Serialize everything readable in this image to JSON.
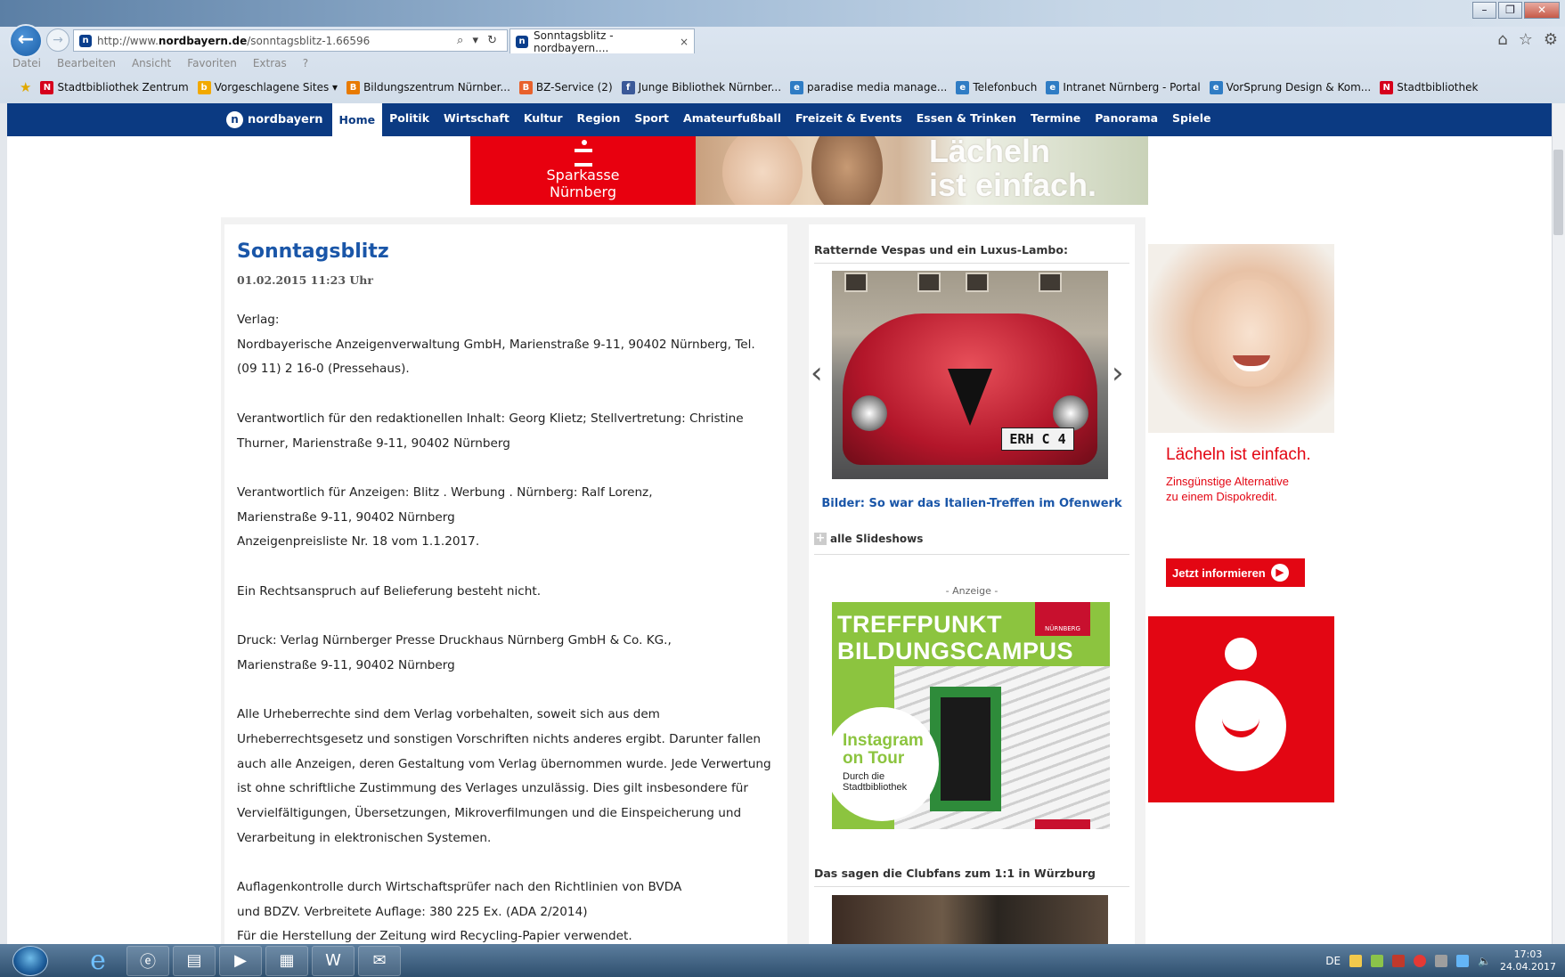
{
  "browser": {
    "url_prefix": "http://www.",
    "url_domain": "nordbayern.de",
    "url_path": "/sonntagsblitz-1.66596",
    "address_controls": "⌕ ▾ ↻",
    "tab_title": "Sonntagsblitz - nordbayern....",
    "tab_close": "×",
    "menu": [
      "Datei",
      "Bearbeiten",
      "Ansicht",
      "Favoriten",
      "Extras",
      "?"
    ],
    "favorites": [
      {
        "label": "Stadtbibliothek Zentrum",
        "icon": "N",
        "color": "#d6001c"
      },
      {
        "label": "Vorgeschlagene Sites ▾",
        "icon": "b",
        "color": "#f2a900"
      },
      {
        "label": "Bildungszentrum Nürnber...",
        "icon": "B",
        "color": "#e87a00"
      },
      {
        "label": "BZ-Service (2)",
        "icon": "B",
        "color": "#e8612c"
      },
      {
        "label": "Junge Bibliothek Nürnber...",
        "icon": "f",
        "color": "#3b5998"
      },
      {
        "label": "paradise media manage...",
        "icon": "e",
        "color": "#2f7cc4"
      },
      {
        "label": "Telefonbuch",
        "icon": "e",
        "color": "#2f7cc4"
      },
      {
        "label": "Intranet Nürnberg - Portal",
        "icon": "e",
        "color": "#2f7cc4"
      },
      {
        "label": "VorSprung Design & Kom...",
        "icon": "e",
        "color": "#2f7cc4"
      },
      {
        "label": "Stadtbibliothek",
        "icon": "N",
        "color": "#d6001c"
      }
    ]
  },
  "site": {
    "logo": "nordbayern",
    "logo_mark": "n",
    "nav": [
      "Home",
      "Politik",
      "Wirtschaft",
      "Kultur",
      "Region",
      "Sport",
      "Amateurfußball",
      "Freizeit & Events",
      "Essen & Trinken",
      "Termine",
      "Panorama",
      "Spiele"
    ],
    "active_nav": "Home"
  },
  "banner_ad": {
    "brand_line1": "Sparkasse",
    "brand_line2": "Nürnberg",
    "slogan_line1": "Lächeln",
    "slogan_line2": "ist einfach."
  },
  "article": {
    "title": "Sonntagsblitz",
    "date": "01.02.2015 11:23 Uhr",
    "paragraphs": [
      [
        "Verlag:",
        "Nordbayerische Anzeigenverwaltung GmbH, Marienstraße 9-11, 90402 Nürnberg, Tel. (09 11) 2 16-0 (Pressehaus)."
      ],
      [
        "Verantwortlich für den redaktionellen Inhalt: Georg Klietz; Stellvertretung: Christine Thurner, Marienstraße 9-11, 90402 Nürnberg"
      ],
      [
        "Verantwortlich für Anzeigen: Blitz . Werbung . Nürnberg: Ralf Lorenz,",
        "Marienstraße 9-11, 90402 Nürnberg",
        "Anzeigenpreisliste Nr. 18 vom 1.1.2017."
      ],
      [
        "Ein Rechtsanspruch auf Belieferung besteht nicht."
      ],
      [
        "Druck: Verlag Nürnberger Presse Druckhaus Nürnberg GmbH & Co. KG.,",
        "Marienstraße 9-11, 90402 Nürnberg"
      ],
      [
        "Alle Urheberrechte sind dem Verlag vorbehalten, soweit sich aus dem Urheberrechtsgesetz und sonstigen Vorschriften nichts anderes ergibt. Darunter fallen auch alle Anzeigen, deren Gestaltung vom Verlag übernommen wurde. Jede Verwertung ist ohne schriftliche Zustimmung des Verlages unzulässig. Dies gilt insbesondere für Vervielfältigungen, Übersetzungen, Mikroverfilmungen und die Einspeicherung und Verarbeitung in elektronischen Systemen."
      ],
      [
        "Auflagenkontrolle durch Wirtschaftsprüfer nach den Richtlinien von BVDA",
        "und BDZV. Verbreitete Auflage: 380 225 Ex. (ADA 2/2014)",
        "Für die Herstellung der Zeitung wird Recycling-Papier verwendet."
      ]
    ]
  },
  "sidebar": {
    "slideshow_heading": "Ratternde Vespas und ein Luxus-Lambo:",
    "plate_text": "ERH C 4",
    "slide_caption": "Bilder: So war das Italien-Treffen im Ofenwerk",
    "all_slideshows": "alle Slideshows",
    "ad_label": "- Anzeige -",
    "campus_ad": {
      "title_line1": "TREFFPUNKT",
      "title_line2": "BILDUNGSCAMPUS",
      "badge": "NÜRNBERG",
      "insta_line1": "Instagram",
      "insta_line2": "on Tour",
      "sub_line1": "Durch die",
      "sub_line2": "Stadtbibliothek"
    },
    "video_heading": "Das sagen die Clubfans zum 1:1 in Würzburg"
  },
  "side_ad": {
    "headline": "Lächeln ist einfach.",
    "sub_line1": "Zinsgünstige Alternative",
    "sub_line2": "zu einem Dispokredit.",
    "button": "Jetzt informieren",
    "accent": "#e30613"
  },
  "taskbar": {
    "lang": "DE",
    "time": "17:03",
    "date": "24.04.2017"
  }
}
